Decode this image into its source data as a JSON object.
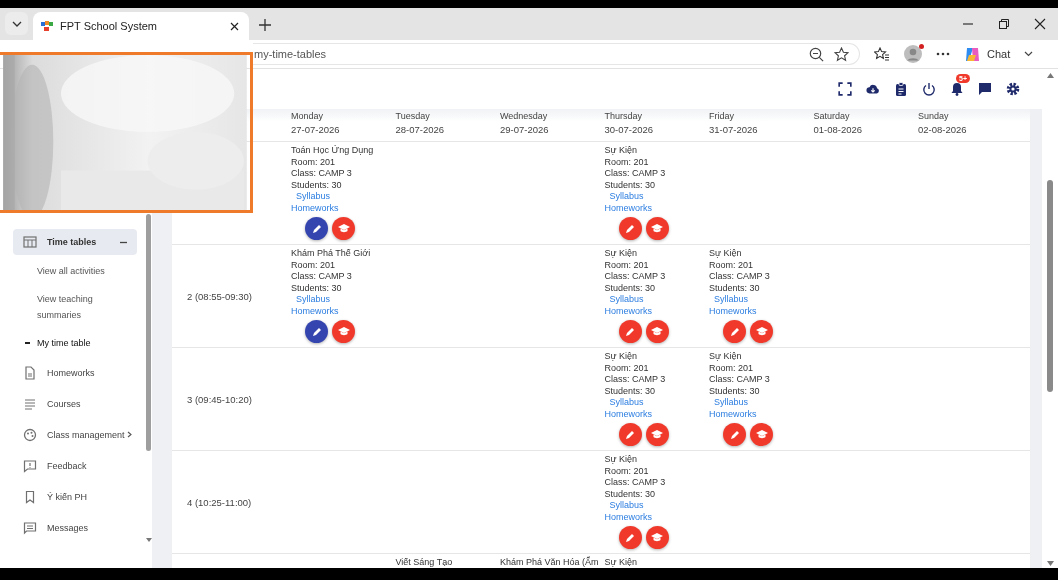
{
  "browser": {
    "tabs": [
      {
        "title": "FPT School System",
        "selected": true
      }
    ],
    "url": "my-time-tables",
    "chat_label": "Chat",
    "profile_alert": true
  },
  "header": {
    "notification_badge": "5+"
  },
  "sidebar": {
    "items": [
      {
        "label": "Time tables",
        "kind": "group",
        "expanded": true,
        "selected": true,
        "children": [
          {
            "label": "View all activities",
            "selected": false
          },
          {
            "label": "View teaching summaries",
            "selected": false
          },
          {
            "label": "My time table",
            "selected": true
          }
        ]
      },
      {
        "label": "Homeworks",
        "kind": "link",
        "selected": false
      },
      {
        "label": "Courses",
        "kind": "link",
        "selected": false
      },
      {
        "label": "Class management",
        "kind": "submenu",
        "selected": false
      },
      {
        "label": "Feedback",
        "kind": "link",
        "selected": false
      },
      {
        "label": "Ý kiến PH",
        "kind": "link",
        "selected": false
      },
      {
        "label": "Messages",
        "kind": "link",
        "selected": false
      }
    ]
  },
  "timetable": {
    "days": [
      {
        "name": "Monday",
        "date": "27-07-2026"
      },
      {
        "name": "Tuesday",
        "date": "28-07-2026"
      },
      {
        "name": "Wednesday",
        "date": "29-07-2026"
      },
      {
        "name": "Thursday",
        "date": "30-07-2026"
      },
      {
        "name": "Friday",
        "date": "31-07-2026"
      },
      {
        "name": "Saturday",
        "date": "01-08-2026"
      },
      {
        "name": "Sunday",
        "date": "02-08-2026"
      }
    ],
    "slots": [
      {
        "cells": [
          {
            "title": "Toán Học Ứng Dụng",
            "room": "Room: 201",
            "class": "Class: CAMP 3",
            "students": "Students: 30",
            "syllabus": "Syllabus",
            "homeworks": "Homeworks",
            "color": "#3545b0"
          },
          null,
          null,
          {
            "title": "Sự Kiện",
            "room": "Room: 201",
            "class": "Class: CAMP 3",
            "students": "Students: 30",
            "syllabus": "Syllabus",
            "homeworks": "Homeworks",
            "color": "#f0392b"
          },
          null,
          null,
          null
        ]
      },
      {
        "label": "2 (08:55-09:30)",
        "cells": [
          {
            "title": "Khám Phá Thế Giới",
            "room": "Room: 201",
            "class": "Class: CAMP 3",
            "students": "Students: 30",
            "syllabus": "Syllabus",
            "homeworks": "Homeworks",
            "color": "#3545b0"
          },
          null,
          null,
          {
            "title": "Sự Kiện",
            "room": "Room: 201",
            "class": "Class: CAMP 3",
            "students": "Students: 30",
            "syllabus": "Syllabus",
            "homeworks": "Homeworks",
            "color": "#f0392b"
          },
          {
            "title": "Sự Kiện",
            "room": "Room: 201",
            "class": "Class: CAMP 3",
            "students": "Students: 30",
            "syllabus": "Syllabus",
            "homeworks": "Homeworks",
            "color": "#f0392b"
          },
          null,
          null
        ]
      },
      {
        "label": "3 (09:45-10:20)",
        "cells": [
          null,
          null,
          null,
          {
            "title": "Sự Kiện",
            "room": "Room: 201",
            "class": "Class: CAMP 3",
            "students": "Students: 30",
            "syllabus": "Syllabus",
            "homeworks": "Homeworks",
            "color": "#f0392b"
          },
          {
            "title": "Sự Kiện",
            "room": "Room: 201",
            "class": "Class: CAMP 3",
            "students": "Students: 30",
            "syllabus": "Syllabus",
            "homeworks": "Homeworks",
            "color": "#f0392b"
          },
          null,
          null
        ]
      },
      {
        "label": "4 (10:25-11:00)",
        "cells": [
          null,
          null,
          null,
          {
            "title": "Sự Kiện",
            "room": "Room: 201",
            "class": "Class: CAMP 3",
            "students": "Students: 30",
            "syllabus": "Syllabus",
            "homeworks": "Homeworks",
            "color": "#f0392b"
          },
          null,
          null,
          null
        ]
      },
      {
        "cells": [
          null,
          {
            "title": "Viết Sáng Tạo"
          },
          {
            "title": "Khám Phá Văn Hóa (Ẩm"
          },
          {
            "title": "Sự Kiện"
          },
          null,
          null,
          null
        ]
      }
    ]
  }
}
